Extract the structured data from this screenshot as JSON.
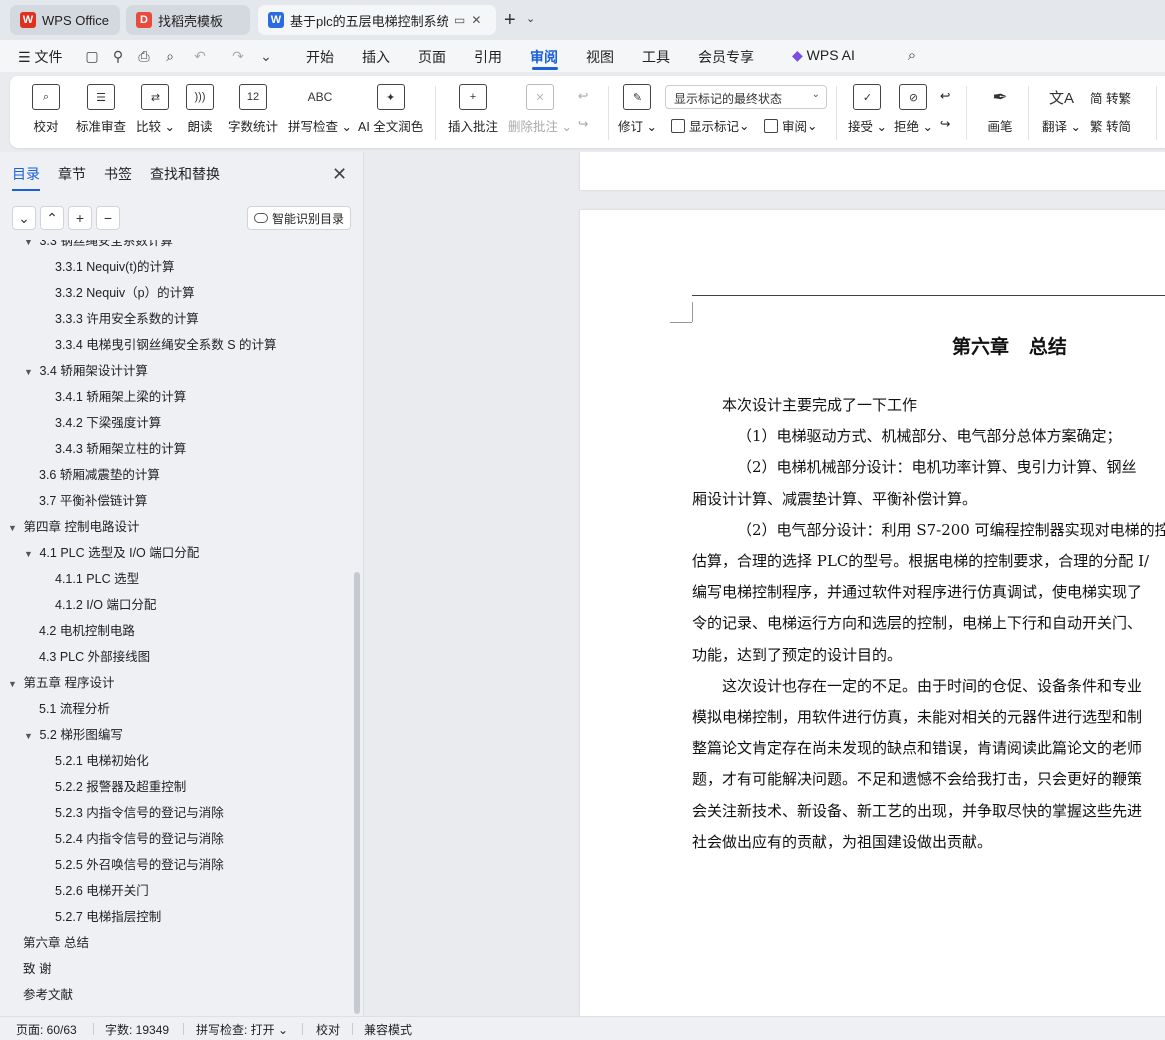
{
  "tabs": [
    {
      "label": "WPS Office",
      "icon": "wps-logo-icon",
      "color": "#e0301e"
    },
    {
      "label": "找稻壳模板",
      "icon": "docer-icon",
      "color": "#e84a3c"
    },
    {
      "label": "基于plc的五层电梯控制系统设",
      "icon": "word-doc-icon",
      "color": "#2b6be0"
    }
  ],
  "menu": {
    "file": "文件",
    "items": [
      "开始",
      "插入",
      "页面",
      "引用",
      "审阅",
      "视图",
      "工具",
      "会员专享"
    ],
    "active": "审阅",
    "ai": "WPS AI"
  },
  "ribbon": {
    "proofread": "校对",
    "standard_review": "标准审查",
    "compare": "比较",
    "read_aloud": "朗读",
    "word_count": "字数统计",
    "word_count_icon_text": "12",
    "spell_check": "拼写检查",
    "spell_icon_text": "ABC",
    "ai_polish": "AI 全文润色",
    "insert_comment": "插入批注",
    "delete_comment": "删除批注",
    "revise": "修订",
    "markup_dropdown": "显示标记的最终状态",
    "show_markup": "显示标记",
    "review": "审阅",
    "accept": "接受",
    "reject": "拒绝",
    "ink": "画笔",
    "translate": "翻译",
    "to_traditional": "简 转繁",
    "to_simplified": "繁 转简"
  },
  "nav": {
    "tabs": [
      "目录",
      "章节",
      "书签",
      "查找和替换"
    ],
    "smart_toc": "智能识别目录",
    "toc": [
      {
        "text": "3.3   钢丝绳安全系数计算",
        "level": 2,
        "expand": true
      },
      {
        "text": "3.3.1 Nequiv(t)的计算",
        "level": 3
      },
      {
        "text": "3.3.2 Nequiv（p）的计算",
        "level": 3
      },
      {
        "text": "3.3.3 许用安全系数的计算",
        "level": 3
      },
      {
        "text": "3.3.4 电梯曳引钢丝绳安全系数 S 的计算",
        "level": 3
      },
      {
        "text": "3.4   轿厢架设计计算",
        "level": 2,
        "expand": true
      },
      {
        "text": "3.4.1 轿厢架上梁的计算",
        "level": 3
      },
      {
        "text": "3.4.2 下梁强度计算",
        "level": 3
      },
      {
        "text": "3.4.3 轿厢架立柱的计算",
        "level": 3
      },
      {
        "text": "3.6 轿厢减震垫的计算",
        "level": 2
      },
      {
        "text": "3.7 平衡补偿链计算",
        "level": 2
      },
      {
        "text": "第四章   控制电路设计",
        "level": 1,
        "expand": true
      },
      {
        "text": "4.1 PLC 选型及 I/O 端口分配",
        "level": 2,
        "expand": true
      },
      {
        "text": "4.1.1 PLC 选型",
        "level": 3
      },
      {
        "text": "4.1.2 I/O 端口分配",
        "level": 3
      },
      {
        "text": "4.2  电机控制电路",
        "level": 2
      },
      {
        "text": "4.3 PLC 外部接线图",
        "level": 2
      },
      {
        "text": "第五章   程序设计",
        "level": 1,
        "expand": true
      },
      {
        "text": "5.1  流程分析",
        "level": 2
      },
      {
        "text": "5.2  梯形图编写",
        "level": 2,
        "expand": true
      },
      {
        "text": "5.2.1  电梯初始化",
        "level": 3
      },
      {
        "text": "5.2.2 报警器及超重控制",
        "level": 3
      },
      {
        "text": "5.2.3  内指令信号的登记与消除",
        "level": 3
      },
      {
        "text": "5.2.4 内指令信号的登记与消除",
        "level": 3
      },
      {
        "text": "5.2.5  外召唤信号的登记与消除",
        "level": 3
      },
      {
        "text": "5.2.6 电梯开关门",
        "level": 3
      },
      {
        "text": "5.2.7 电梯指层控制",
        "level": 3
      },
      {
        "text": "第六章   总结",
        "level": 1
      },
      {
        "text": "致   谢",
        "level": 1
      },
      {
        "text": "参考文献",
        "level": 1
      }
    ]
  },
  "document": {
    "chapter_title": "第六章   总结",
    "lines": [
      {
        "text": "本次设计主要完成了一下工作",
        "indent": 2
      },
      {
        "text": "（1）电梯驱动方式、机械部分、电气部分总体方案确定；",
        "indent": 3
      },
      {
        "text": "（2）电梯机械部分设计：电机功率计算、曳引力计算、钢丝",
        "indent": 3
      },
      {
        "text": "厢设计计算、减震垫计算、平衡补偿计算。",
        "indent": 0
      },
      {
        "text": "（2）电气部分设计：利用 S7-200 可编程控制器实现对电梯的控",
        "indent": 3
      },
      {
        "text": "估算，合理的选择 PLC的型号。根据电梯的控制要求，合理的分配 I/",
        "indent": 0
      },
      {
        "text": "编写电梯控制程序，并通过软件对程序进行仿真调试，使电梯实现了",
        "indent": 0
      },
      {
        "text": "令的记录、电梯运行方向和选层的控制，电梯上下行和自动开关门、",
        "indent": 0
      },
      {
        "text": "功能，达到了预定的设计目的。",
        "indent": 0
      },
      {
        "text": "这次设计也存在一定的不足。由于时间的仓促、设备条件和专业",
        "indent": 2
      },
      {
        "text": "模拟电梯控制，用软件进行仿真，未能对相关的元器件进行选型和制",
        "indent": 0
      },
      {
        "text": "整篇论文肯定存在尚未发现的缺点和错误，肯请阅读此篇论文的老师",
        "indent": 0
      },
      {
        "text": "题，才有可能解决问题。不足和遗憾不会给我打击，只会更好的鞭策",
        "indent": 0
      },
      {
        "text": "会关注新技术、新设备、新工艺的出现，并争取尽快的掌握这些先进",
        "indent": 0
      },
      {
        "text": "社会做出应有的贡献，为祖国建设做出贡献。",
        "indent": 0
      }
    ]
  },
  "status": {
    "page": "页面: 60/63",
    "words": "字数: 19349",
    "spell": "拼写检查: 打开",
    "proof": "校对",
    "compat": "兼容模式"
  }
}
